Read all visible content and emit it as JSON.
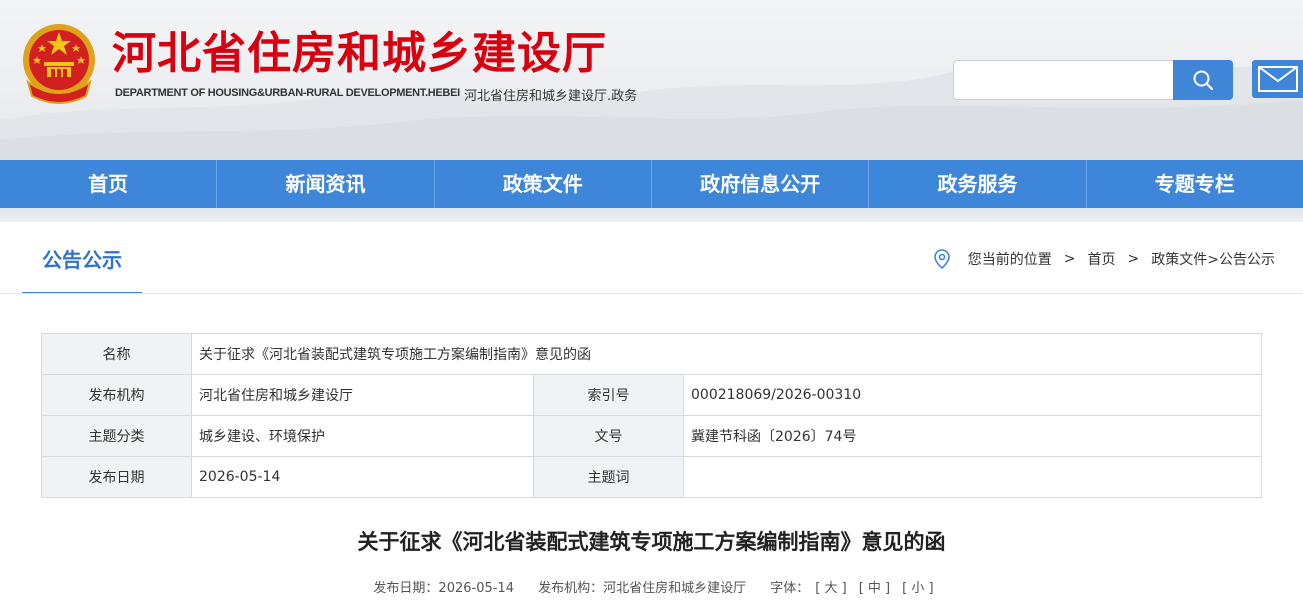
{
  "header": {
    "title": "河北省住房和城乡建设厅",
    "title_en": "DEPARTMENT OF HOUSING&URBAN-RURAL DEVELOPMENT.HEBEI",
    "subtitle": "河北省住房和城乡建设厅.政务",
    "search_placeholder": "",
    "search_icon": "search-icon",
    "mail_icon": "mail-icon",
    "brand_color": "#d7000f"
  },
  "nav": {
    "color": "#3d86d9",
    "items": [
      "首页",
      "新闻资讯",
      "政策文件",
      "政府信息公开",
      "政务服务",
      "专题专栏"
    ]
  },
  "section": {
    "title": "公告公示"
  },
  "breadcrumb": {
    "prefix": "您当前的位置",
    "sep": ">",
    "home": "首页",
    "path": "政策文件>公告公示"
  },
  "meta_table": {
    "name_label": "名称",
    "name_value": "关于征求《河北省装配式建筑专项施工方案编制指南》意见的函",
    "publisher_label": "发布机构",
    "publisher_value": "河北省住房和城乡建设厅",
    "index_label": "索引号",
    "index_value": "000218069/2026-00310",
    "category_label": "主题分类",
    "category_value": "城乡建设、环境保护",
    "docno_label": "文号",
    "docno_value": "冀建节科函〔2026〕74号",
    "date_label": "发布日期",
    "date_value": "2026-05-14",
    "keywords_label": "主题词",
    "keywords_value": ""
  },
  "document": {
    "title": "关于征求《河北省装配式建筑专项施工方案编制指南》意见的函",
    "date_text": "发布日期：2026-05-14",
    "publisher_text": "发布机构：河北省住房和城乡建设厅",
    "font_label": "字体：",
    "font_large": "[ 大 ]",
    "font_medium": "[ 中 ]",
    "font_small": "[ 小 ]"
  }
}
